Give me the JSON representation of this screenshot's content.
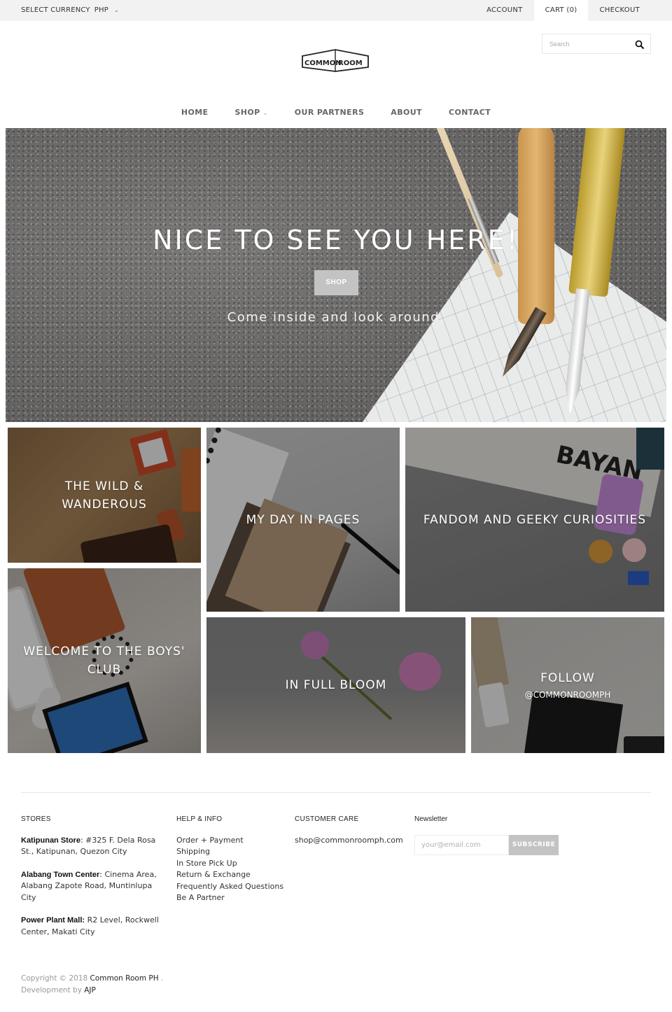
{
  "topbar": {
    "currency_label": "SELECT CURRENCY",
    "currency_value": "PHP",
    "links": [
      {
        "label": "ACCOUNT"
      },
      {
        "label": "CART (0)"
      },
      {
        "label": "CHECKOUT"
      }
    ]
  },
  "logo": {
    "left_word": "COMMON",
    "right_word": "ROOM"
  },
  "search": {
    "placeholder": "Search",
    "icon": "search-icon"
  },
  "nav": {
    "items": [
      {
        "label": "HOME"
      },
      {
        "label": "SHOP",
        "has_dropdown": true
      },
      {
        "label": "OUR PARTNERS"
      },
      {
        "label": "ABOUT"
      },
      {
        "label": "CONTACT"
      }
    ]
  },
  "hero": {
    "title": "NICE TO SEE YOU HERE!",
    "button_label": "SHOP",
    "subtitle": "Come inside and look around."
  },
  "collections": [
    {
      "title": "THE WILD & WANDEROUS"
    },
    {
      "title": "MY DAY IN PAGES"
    },
    {
      "title": "FANDOM AND GEEKY CURIOSITIES"
    },
    {
      "title": "WELCOME TO THE BOYS' CLUB"
    },
    {
      "title": "IN FULL BLOOM"
    },
    {
      "title": "FOLLOW",
      "subtitle": "@COMMONROOMPH"
    }
  ],
  "footer": {
    "stores": {
      "heading": "STORES",
      "items": [
        {
          "name": "Katipunan Store",
          "address": ": #325 F. Dela Rosa St., Katipunan, Quezon City"
        },
        {
          "name": "Alabang Town Center",
          "address": ": Cinema Area, Alabang Zapote Road, Muntinlupa City"
        },
        {
          "name": "Power Plant Mall:",
          "address": " R2 Level, Rockwell Center, Makati City"
        }
      ]
    },
    "help": {
      "heading": "HELP & INFO",
      "links": [
        {
          "label": "Order + Payment"
        },
        {
          "label": "Shipping"
        },
        {
          "label": "In Store Pick Up"
        },
        {
          "label": "Return & Exchange"
        },
        {
          "label": "Frequently Asked Questions"
        },
        {
          "label": "Be A Partner"
        }
      ]
    },
    "care": {
      "heading": "CUSTOMER CARE",
      "email": "shop@commonroomph.com"
    },
    "newsletter": {
      "heading": "Newsletter",
      "placeholder": "your@email.com",
      "button_label": "SUBSCRIBE"
    },
    "copyright": {
      "prefix": "Copyright © 2018 ",
      "brand": "Common Room PH",
      "suffix": " .",
      "dev_prefix": "Development by ",
      "dev_name": "AJP"
    }
  },
  "colors": {
    "topbar_bg": "#f2f2f2",
    "button_gray": "#c3c3c3",
    "text_dark": "#333333"
  }
}
